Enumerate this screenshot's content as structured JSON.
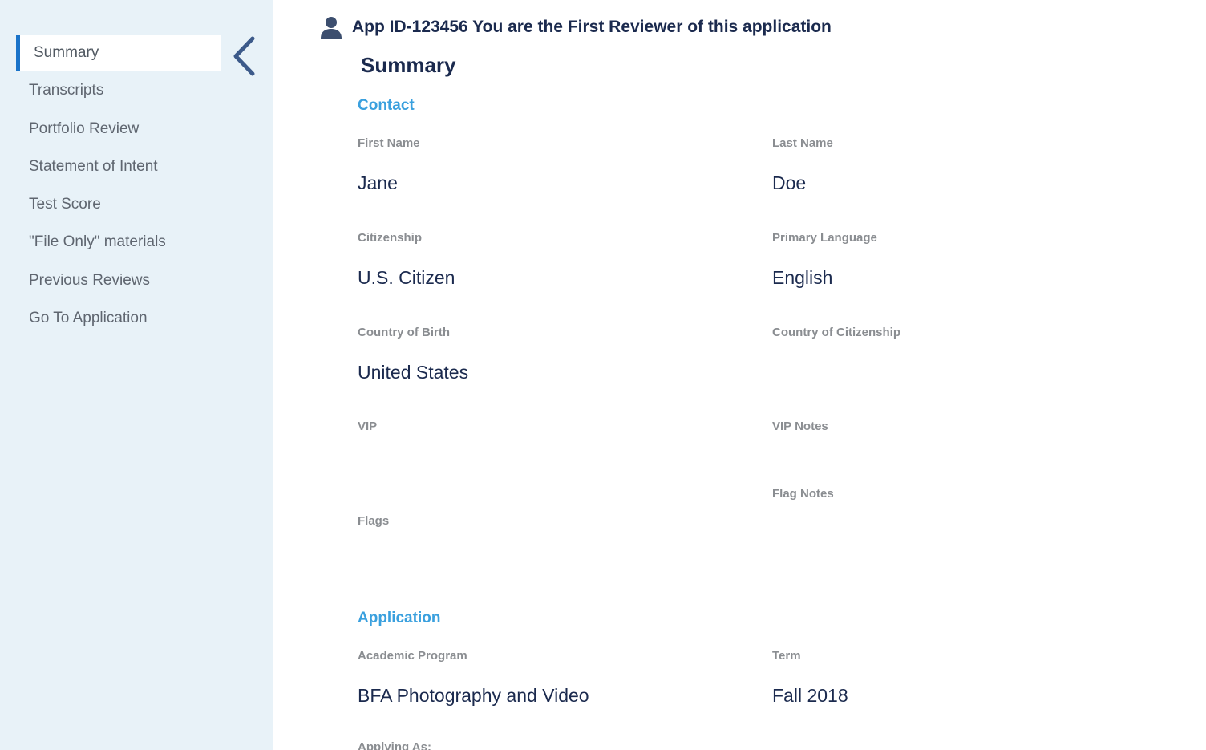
{
  "sidebar": {
    "items": [
      {
        "label": "Summary",
        "active": true
      },
      {
        "label": "Transcripts"
      },
      {
        "label": "Portfolio Review"
      },
      {
        "label": "Statement of Intent"
      },
      {
        "label": "Test Score"
      },
      {
        "label": "\"File Only\" materials"
      },
      {
        "label": "Previous Reviews"
      },
      {
        "label": "Go To Application"
      }
    ],
    "collapse_icon": "chevron-left-icon"
  },
  "header": {
    "icon": "user-icon",
    "text": "App ID-123456 You are the First Reviewer of this application"
  },
  "page_title": "Summary",
  "contact": {
    "title": "Contact",
    "first_name": {
      "label": "First Name",
      "value": "Jane"
    },
    "last_name": {
      "label": "Last Name",
      "value": "Doe"
    },
    "citizenship": {
      "label": "Citizenship",
      "value": "U.S. Citizen"
    },
    "primary_language": {
      "label": "Primary Language",
      "value": "English"
    },
    "country_of_birth": {
      "label": "Country of Birth",
      "value": "United States"
    },
    "country_of_citizenship": {
      "label": "Country of Citizenship",
      "value": ""
    },
    "vip": {
      "label": "VIP",
      "value": ""
    },
    "vip_notes": {
      "label": "VIP Notes",
      "value": ""
    },
    "flag_notes": {
      "label": "Flag Notes",
      "value": ""
    },
    "flags": {
      "label": "Flags",
      "value": ""
    }
  },
  "application": {
    "title": "Application",
    "academic_program": {
      "label": "Academic Program",
      "value": "BFA Photography and Video"
    },
    "term": {
      "label": "Term",
      "value": "Fall 2018"
    },
    "applying_as": {
      "label": "Applying As:",
      "value": ""
    }
  },
  "colors": {
    "sidebar_bg": "#e8f2f8",
    "active_accent": "#1a73c9",
    "navy": "#1b2a4e",
    "section_blue": "#3aa0de",
    "label_gray": "#8a8d91"
  }
}
